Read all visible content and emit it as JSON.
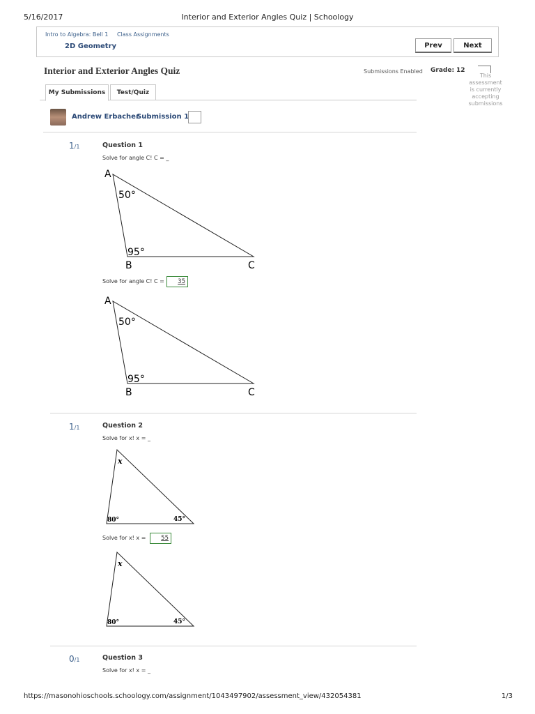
{
  "print": {
    "date": "5/16/2017",
    "title": "Interior and Exterior Angles Quiz | Schoology",
    "url": "https://masonohioschools.schoology.com/assignment/1043497902/assessment_view/432054381",
    "page": "1/3"
  },
  "breadcrumb": [
    "Intro to Algebra: Bell 1",
    "Class Assignments"
  ],
  "course_title": "2D Geometry",
  "nav": {
    "prev_label": "Prev",
    "next_label": "Next"
  },
  "quiz": {
    "title": "Interior and Exterior Angles Quiz",
    "submissions_status": "Submissions Enabled",
    "grade_label": "Grade:",
    "grade_value": "12",
    "accept_note": "This assessment is currently accepting submissions"
  },
  "tabs": [
    {
      "label": "My Submissions",
      "active": true
    },
    {
      "label": "Test/Quiz",
      "active": false
    }
  ],
  "student": {
    "name": "Andrew Erbacher",
    "submission_label": "Submission 1"
  },
  "questions": [
    {
      "score": "1",
      "score_total": "/1",
      "title": "Question 1",
      "prompt": "Solve for angle C!   C = _",
      "answer_prompt": "Solve for angle C!   C =",
      "answer": "35",
      "figure": {
        "vertices": [
          "A",
          "B",
          "C"
        ],
        "angles": [
          "50°",
          "95°"
        ]
      }
    },
    {
      "score": "1",
      "score_total": "/1",
      "title": "Question 2",
      "prompt": "Solve for x!   x = _",
      "answer_prompt": "Solve for x!   x =",
      "answer": "55",
      "figure": {
        "angles": [
          "x",
          "80°",
          "45°"
        ]
      }
    },
    {
      "score": "0",
      "score_total": "/1",
      "title": "Question 3",
      "prompt": "Solve for x!   x = _"
    }
  ],
  "colors": {
    "link": "#2c4a77",
    "score": "#3b5f8a",
    "answer_border": "#3a8a3a"
  }
}
